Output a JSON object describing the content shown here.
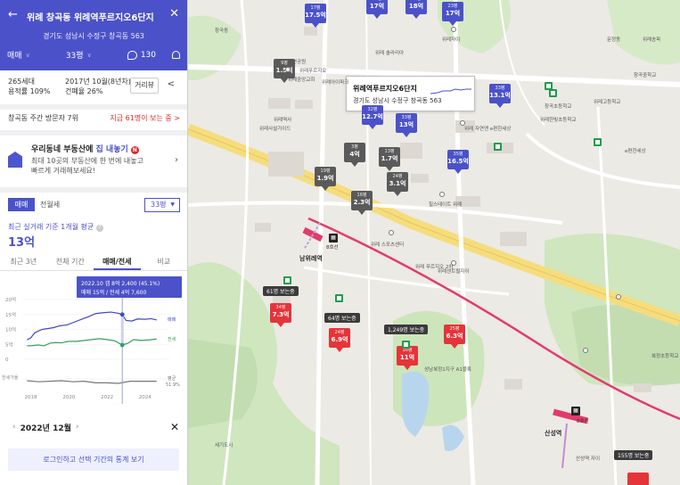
{
  "header": {
    "title": "위례 창곡동 위례역푸르지오6단지",
    "address": "경기도 성남시 수정구 창곡동 563",
    "trade_type": "매매",
    "size": "33평",
    "comment_count": "130"
  },
  "info": {
    "households": "265세대",
    "floor_area_ratio": "용적률 109%",
    "built": "2017년 10월(8년차)",
    "coverage": "건폐율 26%",
    "distance_button": "거리뷰"
  },
  "visitors": {
    "text": "창곡동 주간 방문자 7위",
    "link": "지금 61명이 보는 중 >"
  },
  "promo": {
    "title_a": "우리동네 부동산에",
    "title_b": "집 내놓기",
    "badge": "N",
    "line1": "최대 10곳의 부동산에 한 번에 내놓고",
    "line2": "빠르게 거래해보세요!"
  },
  "price_tabs": {
    "sale": "매매",
    "rent": "전월세",
    "size": "33평"
  },
  "avg": {
    "label": "최근 실거래 기준 1개월 평균",
    "value": "13억"
  },
  "period_tabs": [
    "최근 3년",
    "전체 기간",
    "매매/전세",
    "비교"
  ],
  "active_period_tab": 2,
  "chart_data": {
    "type": "line",
    "tooltip_line1": "2022.10 갭 8억 2,400 (45.1%)",
    "tooltip_line2": "매매 15억 / 전세 4억 7,600",
    "y_ticks": [
      "20억",
      "15억",
      "10억",
      "5억",
      "0"
    ],
    "x_ticks": [
      "2018",
      "2020",
      "2022",
      "2024"
    ],
    "ylim": [
      0,
      20
    ],
    "series": [
      {
        "name": "매매",
        "color": "#3f48c6",
        "x": [
          2017.8,
          2018.0,
          2018.2,
          2018.4,
          2018.6,
          2018.9,
          2019.2,
          2019.5,
          2019.9,
          2020.3,
          2020.7,
          2021.0,
          2021.4,
          2021.8,
          2022.2,
          2022.6,
          2022.8,
          2023.0,
          2023.3,
          2023.6,
          2024.0,
          2024.3,
          2024.6
        ],
        "y": [
          6.5,
          7.2,
          8.8,
          9.5,
          10.0,
          10.3,
          10.6,
          11.2,
          11.5,
          12.5,
          13.5,
          14.2,
          15.3,
          15.6,
          15.8,
          15.4,
          15.0,
          13.0,
          12.8,
          13.5,
          13.4,
          13.6,
          13.2
        ]
      },
      {
        "name": "전세",
        "color": "#33a05b",
        "x": [
          2017.8,
          2018.1,
          2018.4,
          2018.7,
          2019.0,
          2019.3,
          2019.6,
          2020.0,
          2020.4,
          2020.8,
          2021.2,
          2021.6,
          2022.0,
          2022.4,
          2022.8,
          2023.1,
          2023.4,
          2023.8,
          2024.2,
          2024.6
        ],
        "y": [
          4.5,
          4.6,
          4.8,
          4.5,
          5.4,
          5.6,
          5.5,
          6.0,
          6.0,
          6.3,
          6.6,
          6.9,
          6.6,
          6.2,
          4.8,
          5.4,
          6.6,
          6.3,
          6.5,
          6.8
        ]
      },
      {
        "name": "전세가율",
        "color": "#777777",
        "x": [
          2017.8,
          2018.4,
          2019.0,
          2019.6,
          2020.2,
          2020.8,
          2021.4,
          2022.0,
          2022.6,
          2023.2,
          2023.8,
          2024.6
        ],
        "y": [
          -1.5,
          -1.7,
          -1.6,
          -1.5,
          -1.7,
          -1.6,
          -1.9,
          -1.9,
          -2.0,
          -1.6,
          -1.6,
          -1.6
        ]
      }
    ],
    "legend_right": [
      "매매",
      "전세",
      "평균",
      "51.9%"
    ],
    "ratio_label": "전세가율"
  },
  "month": {
    "label": "2022년 12월"
  },
  "login_button": "로그인하고 선택 기간의 통계 보기",
  "map": {
    "callout": {
      "name": "위례역푸르지오6단지",
      "address": "경기도 성남시 수정구 창곡동 563"
    },
    "markers": [
      {
        "kind": "blue",
        "top": "17평",
        "price": "17.5억"
      },
      {
        "kind": "blue",
        "top": "24평",
        "price": "17억"
      },
      {
        "kind": "blue",
        "top": "29평",
        "price": "18억"
      },
      {
        "kind": "blue",
        "top": "23평",
        "price": "17억"
      },
      {
        "kind": "gray",
        "top": "9평",
        "price": "1.5억"
      },
      {
        "kind": "blue",
        "top": "32평",
        "price": "12.7억"
      },
      {
        "kind": "blue",
        "top": "33평",
        "price": "13억"
      },
      {
        "kind": "blue",
        "top": "33평",
        "price": "13.1억"
      },
      {
        "kind": "gray",
        "top": "3평",
        "price": "4억"
      },
      {
        "kind": "gray",
        "top": "13평",
        "price": "1.7억"
      },
      {
        "kind": "gray",
        "top": "19평",
        "price": "1.9억"
      },
      {
        "kind": "gray",
        "top": "24평",
        "price": "3.1억"
      },
      {
        "kind": "gray",
        "top": "16평",
        "price": "2.3억"
      },
      {
        "kind": "blue",
        "top": "35평",
        "price": "16.5억"
      },
      {
        "kind": "red",
        "top": "34평",
        "price": "7.3억"
      },
      {
        "kind": "red",
        "top": "24평",
        "price": "6.9억"
      },
      {
        "kind": "red",
        "top": "30평",
        "price": "11억"
      },
      {
        "kind": "red",
        "top": "25평",
        "price": "6.3억"
      },
      {
        "kind": "red",
        "top": "",
        "price": ""
      }
    ],
    "dark_labels": [
      "61명 보는중",
      "64명 보는중",
      "1,249명 보는중",
      "155명 보는중"
    ],
    "stations": [
      "남위례역",
      "산성역"
    ],
    "line_labels": [
      "8호선",
      "8호선"
    ],
    "place_labels": [
      "위례중앙교회",
      "위례아이파크",
      "위례역사",
      "수변공원",
      "위례푸르지오",
      "위례사설가이드",
      "위례자이",
      "위례 자연앤 e편한세상",
      "창곡초등학교",
      "위례한빛초등학교",
      "위례고등학교",
      "e편한세상",
      "힐스테이트 위례",
      "위례 스포츠센터",
      "위례센트럴자이",
      "창곡중학교",
      "위례 푸르지오 2차",
      "성남복정1지구 A1블록",
      "산성역 자이",
      "창곡동",
      "세기도시",
      "위례 솔라리아",
      "문정동",
      "복정초등학교",
      "위례송파"
    ]
  }
}
